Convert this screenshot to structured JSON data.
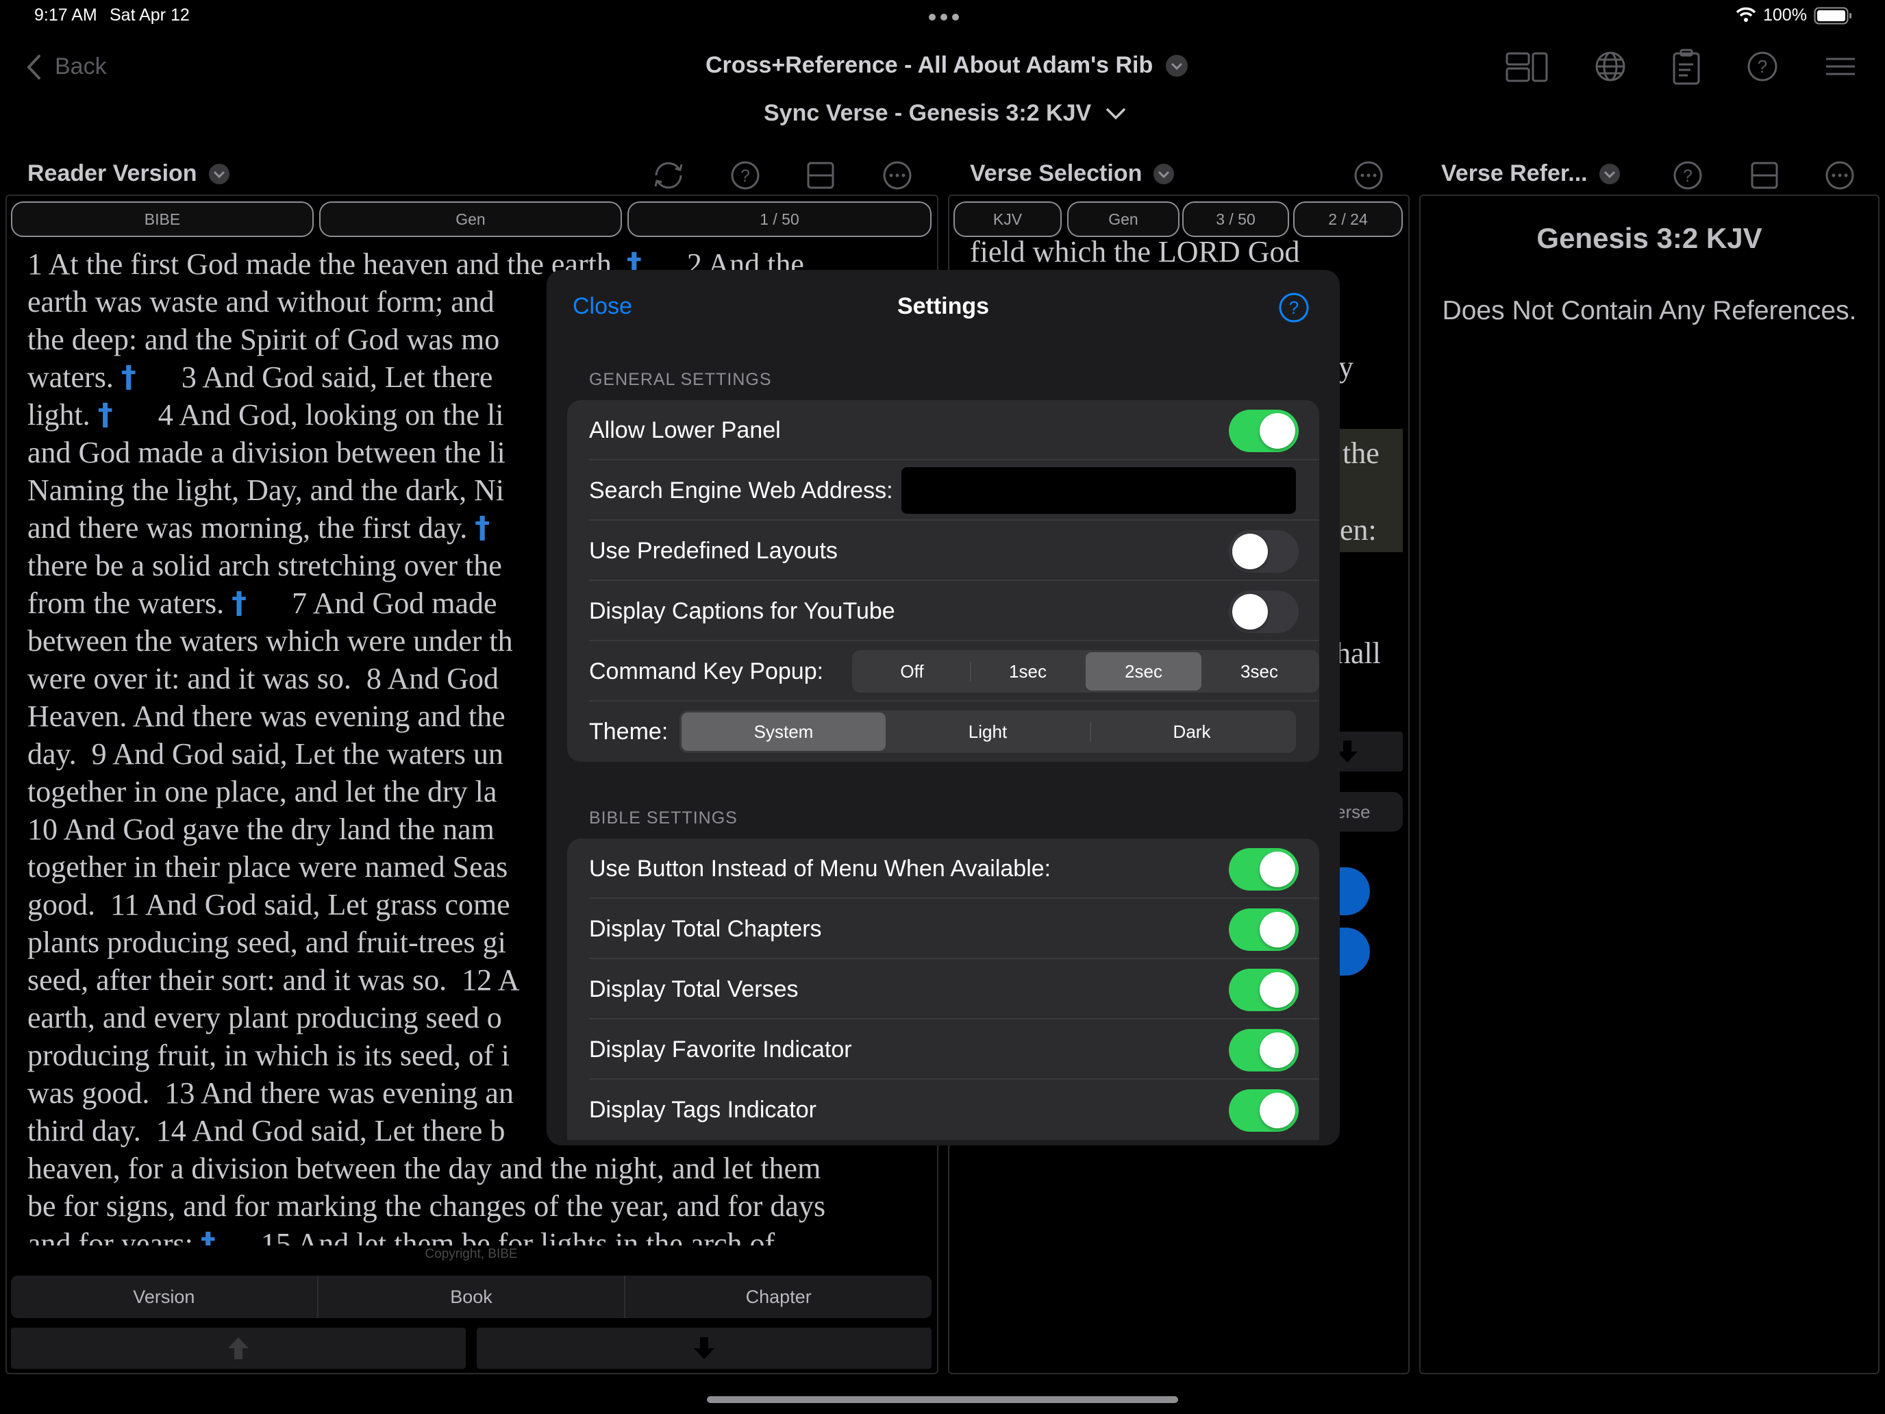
{
  "status_bar": {
    "time": "9:17 AM",
    "date": "Sat Apr 12",
    "battery": "100%"
  },
  "nav": {
    "back_label": "Back",
    "title": "Cross+Reference - All About Adam's Rib",
    "subtitle": "Sync Verse - Genesis 3:2 KJV"
  },
  "reader_panel": {
    "title": "Reader Version",
    "pills": [
      "BIBE",
      "Gen",
      "1 / 50"
    ],
    "copyright": "Copyright, BIBE",
    "tabs": [
      "Version",
      "Book",
      "Chapter"
    ],
    "lines": [
      [
        "1 At the first God made the heaven and the earth. ",
        "†",
        "      2 And the"
      ],
      [
        "earth was waste and without form; and",
        "",
        ""
      ],
      [
        "the deep: and the Spirit of God was mo",
        "",
        ""
      ],
      [
        "waters. ",
        "†",
        "      3 And God said, Let there"
      ],
      [
        "light. ",
        "†",
        "      4 And God, looking on the li"
      ],
      [
        "and God made a division between the li",
        "",
        ""
      ],
      [
        "Naming the light, Day, and the dark, Ni",
        "",
        ""
      ],
      [
        "and there was morning, the first day. ",
        "†",
        ""
      ],
      [
        "there be a solid arch stretching over the",
        "",
        ""
      ],
      [
        "from the waters. ",
        "†",
        "      7 And God made"
      ],
      [
        "between the waters which were under th",
        "",
        ""
      ],
      [
        "were over it: and it was so.  8 And God",
        "",
        ""
      ],
      [
        "Heaven. And there was evening and the",
        "",
        ""
      ],
      [
        "day.  9 And God said, Let the waters un",
        "",
        ""
      ],
      [
        "together in one place, and let the dry la",
        "",
        ""
      ],
      [
        "10 And God gave the dry land the nam",
        "",
        ""
      ],
      [
        "together in their place were named Seas",
        "",
        ""
      ],
      [
        "good.  11 And God said, Let grass come",
        "",
        ""
      ],
      [
        "plants producing seed, and fruit-trees gi",
        "",
        ""
      ],
      [
        "seed, after their sort: and it was so.  12 A",
        "",
        ""
      ],
      [
        "earth, and every plant producing seed o",
        "",
        ""
      ],
      [
        "producing fruit, in which is its seed, of i",
        "",
        ""
      ],
      [
        "was good.  13 And there was evening an",
        "",
        ""
      ],
      [
        "third day.  14 And God said, Let there b",
        "",
        ""
      ],
      [
        "heaven, for a division between the day and the night, and let them",
        "",
        ""
      ],
      [
        "be for signs, and for marking the changes of the year, and for days",
        "",
        ""
      ],
      [
        "and for years: ",
        "†",
        "      15 And let them be for lights in the arch of"
      ]
    ]
  },
  "verse_panel": {
    "title": "Verse Selection",
    "pills": [
      "KJV",
      "Gen",
      "3 / 50",
      "2 / 24"
    ],
    "fragments": [
      "field which the LORD God",
      "y",
      "the",
      "en:",
      "hall",
      "erse"
    ]
  },
  "ref_panel": {
    "title": "Verse Refer...",
    "heading": "Genesis 3:2 KJV",
    "message": "Does Not Contain Any References."
  },
  "settings": {
    "close_label": "Close",
    "title": "Settings",
    "general_header": "GENERAL SETTINGS",
    "allow_lower_panel": {
      "label": "Allow Lower Panel",
      "on": true
    },
    "search_engine": {
      "label": "Search Engine Web Address:",
      "value": ""
    },
    "use_predefined_layouts": {
      "label": "Use Predefined Layouts",
      "on": false
    },
    "display_captions": {
      "label": "Display Captions for YouTube",
      "on": false
    },
    "command_key": {
      "label": "Command Key Popup:",
      "options": [
        "Off",
        "1sec",
        "2sec",
        "3sec"
      ],
      "selected": "2sec"
    },
    "theme": {
      "label": "Theme:",
      "options": [
        "System",
        "Light",
        "Dark"
      ],
      "selected": "System"
    },
    "bible_header": "BIBLE SETTINGS",
    "bible_rows": [
      {
        "label": "Use Button Instead of Menu When Available:",
        "on": true
      },
      {
        "label": "Display Total Chapters",
        "on": true
      },
      {
        "label": "Display Total Verses",
        "on": true
      },
      {
        "label": "Display Favorite Indicator",
        "on": true
      },
      {
        "label": "Display Tags Indicator",
        "on": true
      }
    ]
  }
}
